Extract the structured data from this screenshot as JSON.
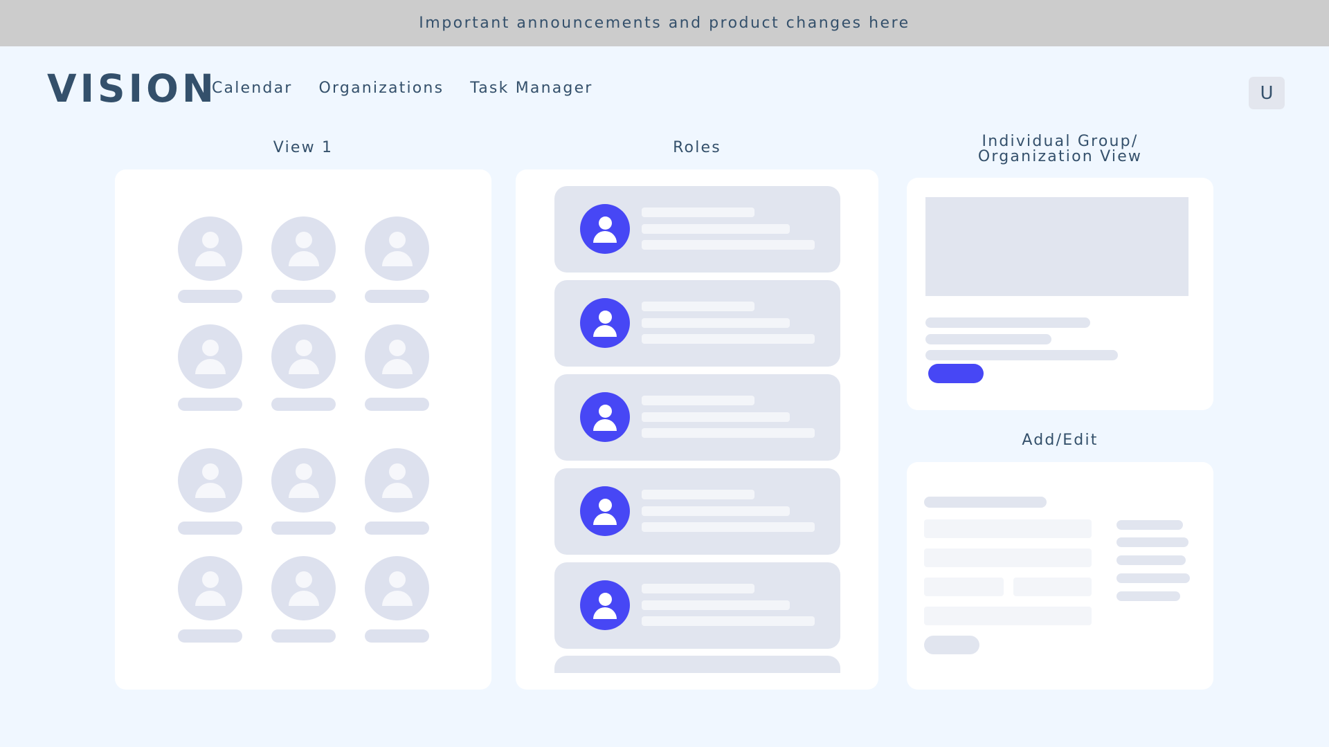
{
  "banner": {
    "text": "Important announcements and product changes here"
  },
  "header": {
    "logo": "VISION",
    "nav": [
      "Calendar",
      "Organizations",
      "Task Manager"
    ],
    "user_initial": "U"
  },
  "sections": {
    "view1_title": "View 1",
    "roles_title": "Roles",
    "group_title_line1": "Individual Group/",
    "group_title_line2": "Organization View",
    "addedit_title": "Add/Edit"
  },
  "colors": {
    "background": "#f0f7ff",
    "banner": "#cccccc",
    "text": "#34506b",
    "accent": "#4747f5",
    "placeholder": "#dde1ee",
    "card": "#e1e5ef"
  }
}
